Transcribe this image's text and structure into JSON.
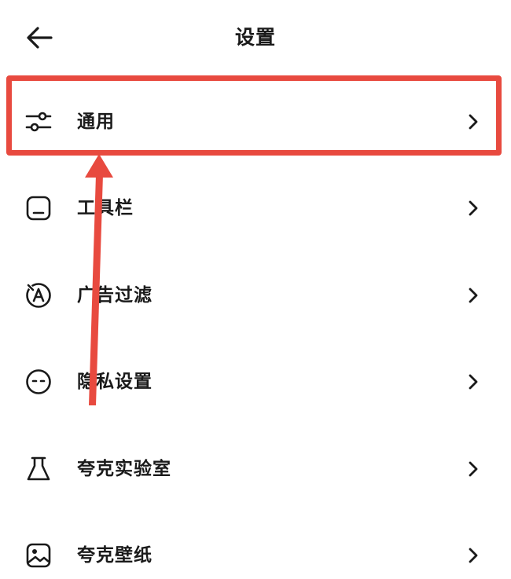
{
  "header": {
    "title": "设置"
  },
  "menu": {
    "items": [
      {
        "label": "通用",
        "icon": "sliders-icon"
      },
      {
        "label": "工具栏",
        "icon": "toolbar-icon"
      },
      {
        "label": "广告过滤",
        "icon": "ad-filter-icon"
      },
      {
        "label": "隐私设置",
        "icon": "privacy-icon"
      },
      {
        "label": "夸克实验室",
        "icon": "flask-icon"
      },
      {
        "label": "夸克壁纸",
        "icon": "wallpaper-icon"
      }
    ]
  },
  "annotation": {
    "color": "#e84a3f"
  }
}
